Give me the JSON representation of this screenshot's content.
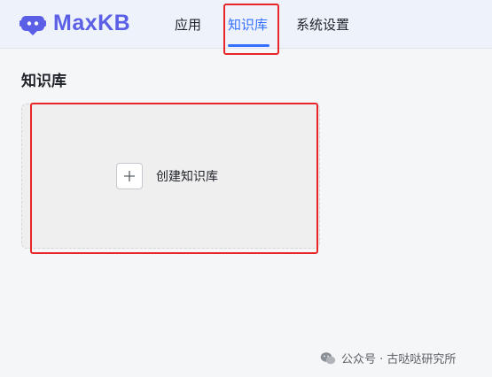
{
  "header": {
    "logo_text": "MaxKB",
    "nav": [
      {
        "label": "应用",
        "active": false
      },
      {
        "label": "知识库",
        "active": true
      },
      {
        "label": "系统设置",
        "active": false
      }
    ],
    "accent_color": "#3370ff",
    "logo_color": "#5a5fe6"
  },
  "main": {
    "title": "知识库",
    "create_card": {
      "label": "创建知识库",
      "icon": "plus-icon"
    }
  },
  "annotations": {
    "highlight_color": "#e8262a"
  },
  "watermark": {
    "text": "公众号 · 古哒哒研究所",
    "icon": "wechat-icon"
  }
}
